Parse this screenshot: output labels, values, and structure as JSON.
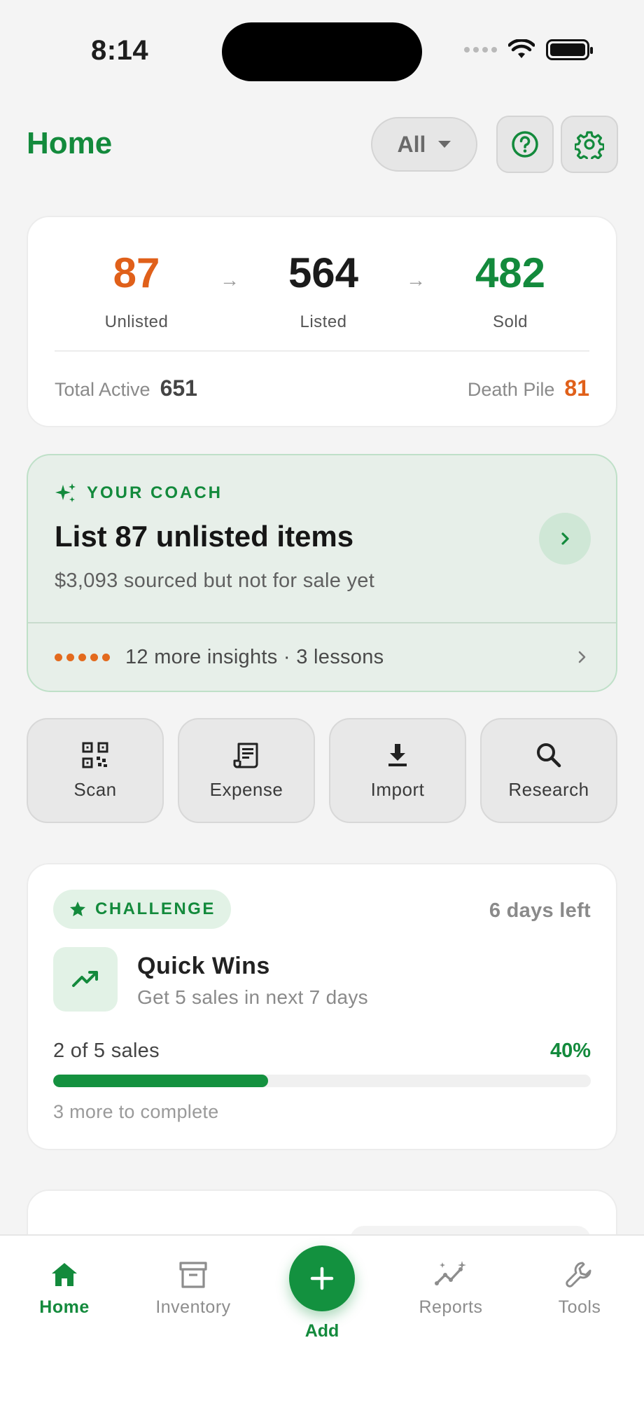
{
  "status_bar": {
    "time": "8:14"
  },
  "header": {
    "title": "Home",
    "filter_value": "All"
  },
  "stats": {
    "unlisted": {
      "value": "87",
      "label": "Unlisted",
      "color": "#e0601a"
    },
    "listed": {
      "value": "564",
      "label": "Listed",
      "color": "#1b1b1b"
    },
    "sold": {
      "value": "482",
      "label": "Sold",
      "color": "#138a3c"
    },
    "total_active_label": "Total Active",
    "total_active_value": "651",
    "death_pile_label": "Death Pile",
    "death_pile_value": "81"
  },
  "coach": {
    "kicker": "YOUR COACH",
    "title": "List 87 unlisted items",
    "subtitle": "$3,093 sourced but not for sale yet",
    "insights": "12 more insights · 3 lessons"
  },
  "actions": [
    {
      "label": "Scan",
      "icon": "qr-scan-icon"
    },
    {
      "label": "Expense",
      "icon": "receipt-icon"
    },
    {
      "label": "Import",
      "icon": "download-icon"
    },
    {
      "label": "Research",
      "icon": "search-icon"
    }
  ],
  "challenge": {
    "badge": "CHALLENGE",
    "days_left": "6 days left",
    "title": "Quick Wins",
    "description": "Get 5 sales in next 7 days",
    "progress_label": "2 of 5 sales",
    "percent_label": "40%",
    "progress": 0.4,
    "remaining": "3 more to complete"
  },
  "tabs": [
    {
      "label": "Home",
      "icon": "home-icon",
      "active": true
    },
    {
      "label": "Inventory",
      "icon": "archive-box-icon"
    },
    {
      "label": "Add",
      "icon": "plus-icon"
    },
    {
      "label": "Reports",
      "icon": "sparkle-chart-icon"
    },
    {
      "label": "Tools",
      "icon": "wrench-icon"
    }
  ],
  "colors": {
    "brand": "#138a3c",
    "warning": "#e0601a"
  }
}
